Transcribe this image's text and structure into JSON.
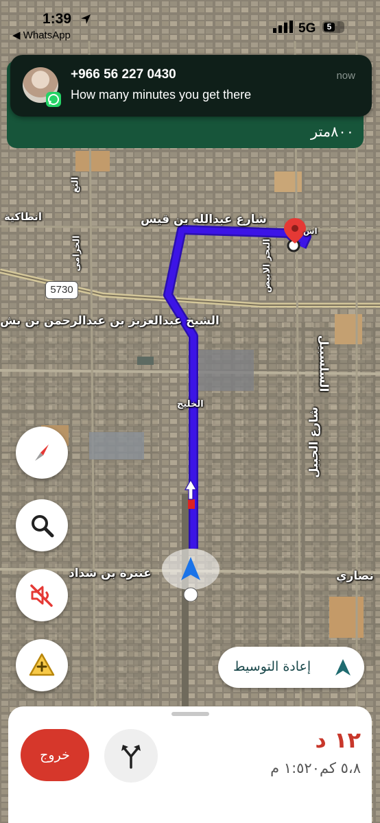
{
  "status_bar": {
    "time": "1:39",
    "back_app": "◀ WhatsApp",
    "network": "5G",
    "battery": "5"
  },
  "notification": {
    "sender": "+966 56 227 0430",
    "message": "How many minutes you get there",
    "time": "now"
  },
  "nav_banner": {
    "distance": "٨٠٠متر"
  },
  "map": {
    "highway_shield": "5730",
    "labels": {
      "abdullah_bin_qais": "شارع عبدالله بن قيس",
      "antakya": "انطاكية",
      "abdulaziz": "الشيخ عبدالعزيز بن عبدالرحمن بن بش",
      "khaleej": "الخليج",
      "antarah": "عنترة بن شداد",
      "ansari": "نصاري",
      "salsabil": "السلسبيل",
      "shari_jabal": "شارع الجبيل",
      "bahr_abyad": "البحر الابيض",
      "khuzama": "الخزامى",
      "al_ta": "الثغ",
      "ashe": "اش"
    }
  },
  "controls": {
    "recenter_label": "إعادة التوسيط"
  },
  "bottom_sheet": {
    "exit_label": "خروج",
    "eta_minutes": "١٢ د",
    "eta_details": "٥،٨ كم١:٥٢٠ م"
  },
  "colors": {
    "route": "#3c14e6",
    "banner": "#17553a",
    "exit": "#d6372b",
    "eta": "#c8372b",
    "pin": "#e53935"
  }
}
